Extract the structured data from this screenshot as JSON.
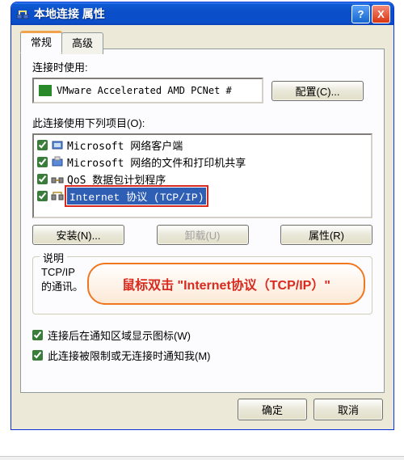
{
  "window": {
    "title": "本地连接 属性"
  },
  "titlebuttons": {
    "help": "?",
    "close": "X"
  },
  "tabs": {
    "general": "常规",
    "advanced": "高级"
  },
  "connect_using": {
    "label": "连接时使用:",
    "device": "VMware Accelerated AMD PCNet #",
    "configure_btn": "配置(C)..."
  },
  "items_label": "此连接使用下列项目(O):",
  "items": [
    {
      "checked": true,
      "label": "Microsoft 网络客户端",
      "selected": false,
      "icon": "client"
    },
    {
      "checked": true,
      "label": "Microsoft 网络的文件和打印机共享",
      "selected": false,
      "icon": "share"
    },
    {
      "checked": true,
      "label": "QoS 数据包计划程序",
      "selected": false,
      "icon": "qos"
    },
    {
      "checked": true,
      "label": "Internet 协议 (TCP/IP)",
      "selected": true,
      "icon": "proto"
    }
  ],
  "buttons": {
    "install": "安装(N)...",
    "uninstall": "卸载(U)",
    "properties": "属性(R)"
  },
  "description": {
    "legend": "说明",
    "text_line1": "TCP/IP ",
    "text_line2": "的通讯。"
  },
  "checks": {
    "show_icon": "连接后在通知区域显示图标(W)",
    "notify": "此连接被限制或无连接时通知我(M)"
  },
  "dialog_buttons": {
    "ok": "确定",
    "cancel": "取消"
  },
  "callout": {
    "text": "鼠标双击 \"Internet协议（TCP/IP）\""
  }
}
